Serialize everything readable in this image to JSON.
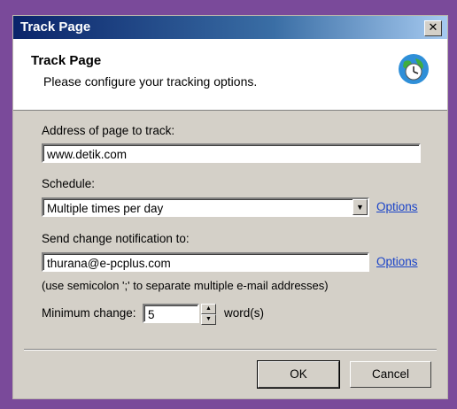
{
  "window": {
    "title": "Track Page",
    "close_label": "✕"
  },
  "header": {
    "title": "Track Page",
    "subtitle": "Please configure your tracking options.",
    "icon": "globe-clock-icon"
  },
  "form": {
    "address_label": "Address of page to track:",
    "address_value": "www.detik.com",
    "schedule_label": "Schedule:",
    "schedule_value": "Multiple times per day",
    "schedule_options_link": "Options",
    "notify_label": "Send change notification to:",
    "notify_value": "thurana@e-pcplus.com",
    "notify_options_link": "Options",
    "notify_hint": "(use semicolon ';' to separate multiple e-mail addresses)",
    "min_change_label": "Minimum change:",
    "min_change_value": "5",
    "min_change_unit": "word(s)"
  },
  "buttons": {
    "ok": "OK",
    "cancel": "Cancel"
  },
  "colors": {
    "title_gradient_start": "#0a246a",
    "link": "#1a43c8",
    "frame_bg": "#d4d0c8",
    "page_bg": "#7a4a9a"
  }
}
